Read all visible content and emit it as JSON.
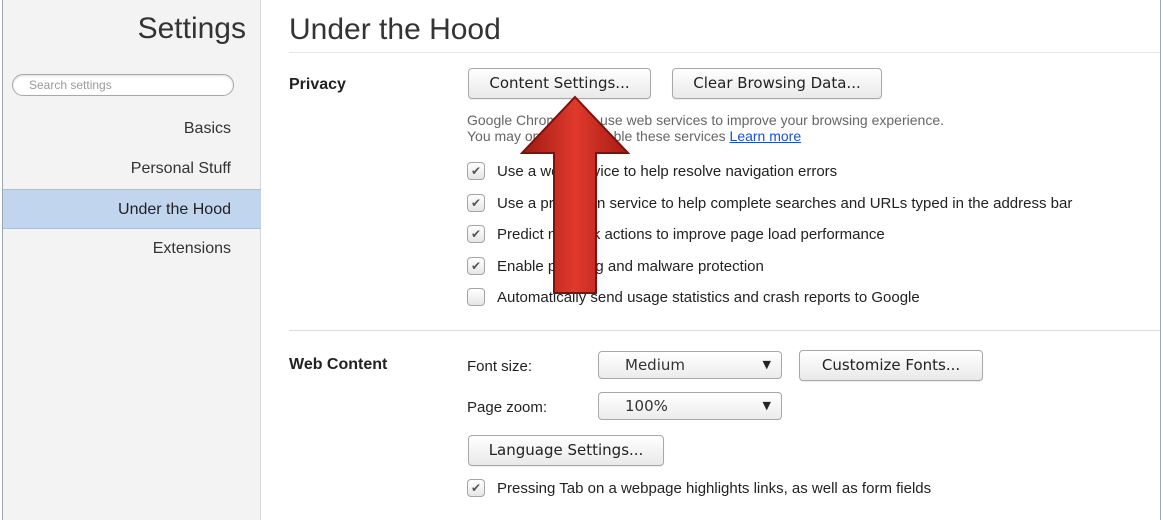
{
  "sidebar": {
    "title": "Settings",
    "search_placeholder": "Search settings",
    "items": [
      {
        "label": "Basics"
      },
      {
        "label": "Personal Stuff"
      },
      {
        "label": "Under the Hood"
      },
      {
        "label": "Extensions"
      }
    ],
    "active_item": "Under the Hood"
  },
  "main": {
    "title": "Under the Hood",
    "privacy": {
      "label": "Privacy",
      "content_settings_button": "Content Settings...",
      "clear_browsing_button": "Clear Browsing Data...",
      "desc_line1": "Google Chrome may use web services to improve your browsing experience.",
      "desc_line2_prefix": "You may optionally disable these services",
      "learn_more": "Learn more",
      "options": [
        {
          "label": "Use a web service to help resolve navigation errors",
          "checked": true
        },
        {
          "label": "Use a prediction service to help complete searches and URLs typed in the address bar",
          "checked": true
        },
        {
          "label": "Predict network actions to improve page load performance",
          "checked": true
        },
        {
          "label": "Enable phishing and malware protection",
          "checked": true
        },
        {
          "label": "Automatically send usage statistics and crash reports to Google",
          "checked": false
        }
      ]
    },
    "web_content": {
      "label": "Web Content",
      "font_size_label": "Font size:",
      "font_size_value": "Medium",
      "customize_fonts_button": "Customize Fonts...",
      "page_zoom_label": "Page zoom:",
      "page_zoom_value": "100%",
      "language_settings_button": "Language Settings...",
      "tab_highlight_label": "Pressing Tab on a webpage highlights links, as well as form fields",
      "tab_highlight_checked": true
    }
  },
  "colors": {
    "sidebar_bg": "#f3f3f3",
    "active_item_bg": "#c2d5ee",
    "link": "#1a4fd6",
    "arrow": "#d42a1f"
  },
  "icons": {
    "checkmark": "check-icon",
    "dropdown": "chevron-down-icon",
    "annotation": "red-up-arrow-icon"
  }
}
